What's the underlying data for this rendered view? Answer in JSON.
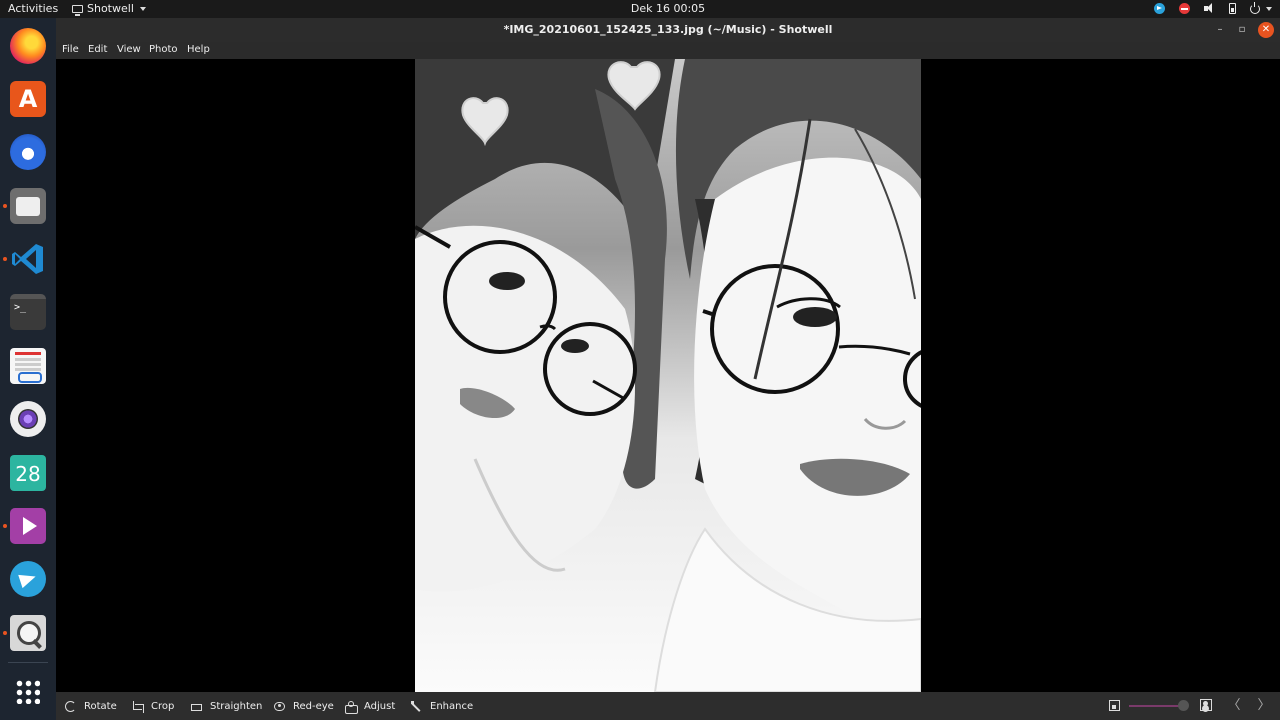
{
  "topbar": {
    "activities": "Activities",
    "app_name": "Shotwell",
    "clock": "Dek 16  00:05",
    "tray_icons": [
      "telegram-icon",
      "do-not-disturb-icon",
      "volume-icon",
      "battery-icon",
      "power-icon"
    ]
  },
  "dock": {
    "apps": [
      {
        "name": "firefox",
        "running": false
      },
      {
        "name": "ubuntu-software",
        "glyph": "A",
        "running": false
      },
      {
        "name": "thunderbird",
        "running": false
      },
      {
        "name": "files",
        "running": true
      },
      {
        "name": "visual-studio-code",
        "running": true
      },
      {
        "name": "terminal",
        "glyph": ">_",
        "running": false
      },
      {
        "name": "screenshot-reader",
        "running": false
      },
      {
        "name": "webcam",
        "running": false
      },
      {
        "name": "calendar",
        "glyph": "28",
        "running": false
      },
      {
        "name": "video-player",
        "running": true
      },
      {
        "name": "telegram",
        "running": false
      },
      {
        "name": "search-tool",
        "running": true
      },
      {
        "name": "show-applications"
      }
    ]
  },
  "window": {
    "title": "*IMG_20210601_152425_133.jpg (~/Music) - Shotwell",
    "controls": {
      "minimize": "–",
      "maximize": "▫",
      "close": "✕"
    }
  },
  "menubar": {
    "items": [
      "File",
      "Edit",
      "View",
      "Photo",
      "Help"
    ]
  },
  "toolbar": {
    "tools": [
      "Rotate",
      "Crop",
      "Straighten",
      "Red-eye",
      "Adjust",
      "Enhance"
    ],
    "zoom_level": 0.98,
    "prev": "〈",
    "next": "〉"
  },
  "colors": {
    "accent": "#e95420",
    "dock_bg": "#1d2530",
    "titlebar_bg": "#2c2c2c",
    "toolbar_bg": "#2d2d2d",
    "telegram_blue": "#2aa2db"
  }
}
